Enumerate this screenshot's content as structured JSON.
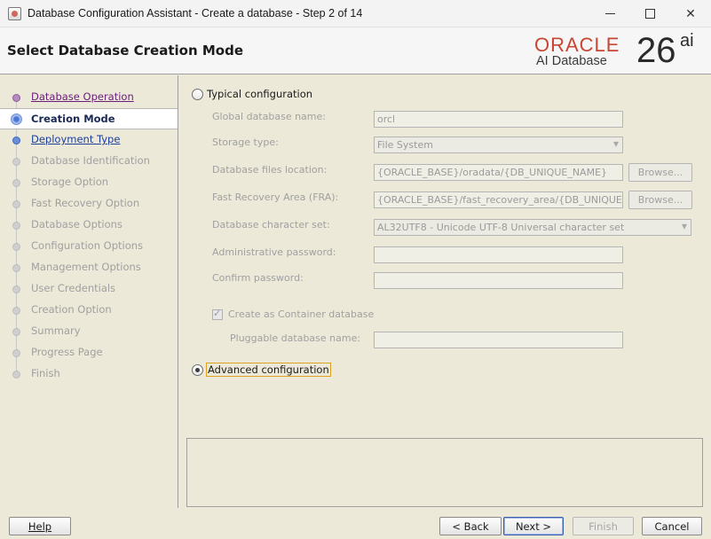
{
  "window": {
    "title": "Database Configuration Assistant - Create a database - Step 2 of 14"
  },
  "header": {
    "page_title": "Select Database Creation Mode",
    "logo_oracle": "ORACLE",
    "logo_product": "AI Database",
    "logo_version": "26",
    "logo_suffix": "ai"
  },
  "steps": [
    {
      "label": "Database Operation",
      "state": "visited"
    },
    {
      "label": "Creation Mode",
      "state": "current"
    },
    {
      "label": "Deployment Type",
      "state": "link"
    },
    {
      "label": "Database Identification",
      "state": "disabled"
    },
    {
      "label": "Storage Option",
      "state": "disabled"
    },
    {
      "label": "Fast Recovery Option",
      "state": "disabled"
    },
    {
      "label": "Database Options",
      "state": "disabled"
    },
    {
      "label": "Configuration Options",
      "state": "disabled"
    },
    {
      "label": "Management Options",
      "state": "disabled"
    },
    {
      "label": "User Credentials",
      "state": "disabled"
    },
    {
      "label": "Creation Option",
      "state": "disabled"
    },
    {
      "label": "Summary",
      "state": "disabled"
    },
    {
      "label": "Progress Page",
      "state": "disabled"
    },
    {
      "label": "Finish",
      "state": "disabled"
    }
  ],
  "typical": {
    "label": "Typical configuration",
    "selected": false,
    "global_db_name_label": "Global database name:",
    "global_db_name_value": "orcl",
    "storage_type_label": "Storage type:",
    "storage_type_value": "File System",
    "db_files_location_label": "Database files location:",
    "db_files_location_value": "{ORACLE_BASE}/oradata/{DB_UNIQUE_NAME}",
    "fra_label": "Fast Recovery Area (FRA):",
    "fra_value": "{ORACLE_BASE}/fast_recovery_area/{DB_UNIQUE_NAME}",
    "charset_label": "Database character set:",
    "charset_value": "AL32UTF8 - Unicode UTF-8 Universal character set",
    "admin_password_label": "Administrative password:",
    "admin_password_value": "",
    "confirm_password_label": "Confirm password:",
    "confirm_password_value": "",
    "container_db_label": "Create as Container database",
    "container_db_checked": true,
    "pluggable_db_label": "Pluggable database name:",
    "pluggable_db_value": "",
    "browse_label": "Browse..."
  },
  "advanced": {
    "label": "Advanced configuration",
    "selected": true
  },
  "buttons": {
    "help": "Help",
    "back": "< Back",
    "next": "Next >",
    "finish": "Finish",
    "cancel": "Cancel"
  }
}
